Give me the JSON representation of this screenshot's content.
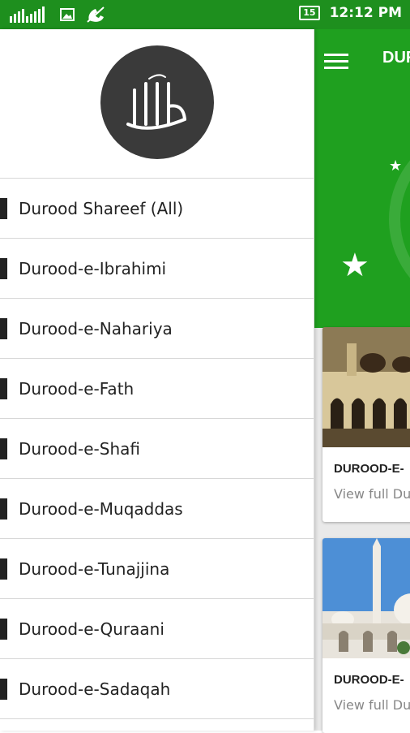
{
  "status_bar": {
    "battery": "15",
    "time": "12:12 PM"
  },
  "main": {
    "toolbar_title": "DUR",
    "cards": [
      {
        "title": "DUROOD-E-",
        "subtitle": "View full Du"
      },
      {
        "title": "DUROOD-E-",
        "subtitle": "View full Du"
      }
    ]
  },
  "drawer": {
    "menu_items": [
      {
        "label": "Durood Shareef (All)"
      },
      {
        "label": "Durood-e-Ibrahimi"
      },
      {
        "label": "Durood-e-Nahariya"
      },
      {
        "label": "Durood-e-Fath"
      },
      {
        "label": "Durood-e-Shafi"
      },
      {
        "label": "Durood-e-Muqaddas"
      },
      {
        "label": "Durood-e-Tunajjina"
      },
      {
        "label": "Durood-e-Quraani"
      },
      {
        "label": "Durood-e-Sadaqah"
      }
    ]
  },
  "colors": {
    "status_bar": "#1e8f1e",
    "toolbar": "#1fa01f",
    "logo_circle": "#3a3a3a"
  }
}
